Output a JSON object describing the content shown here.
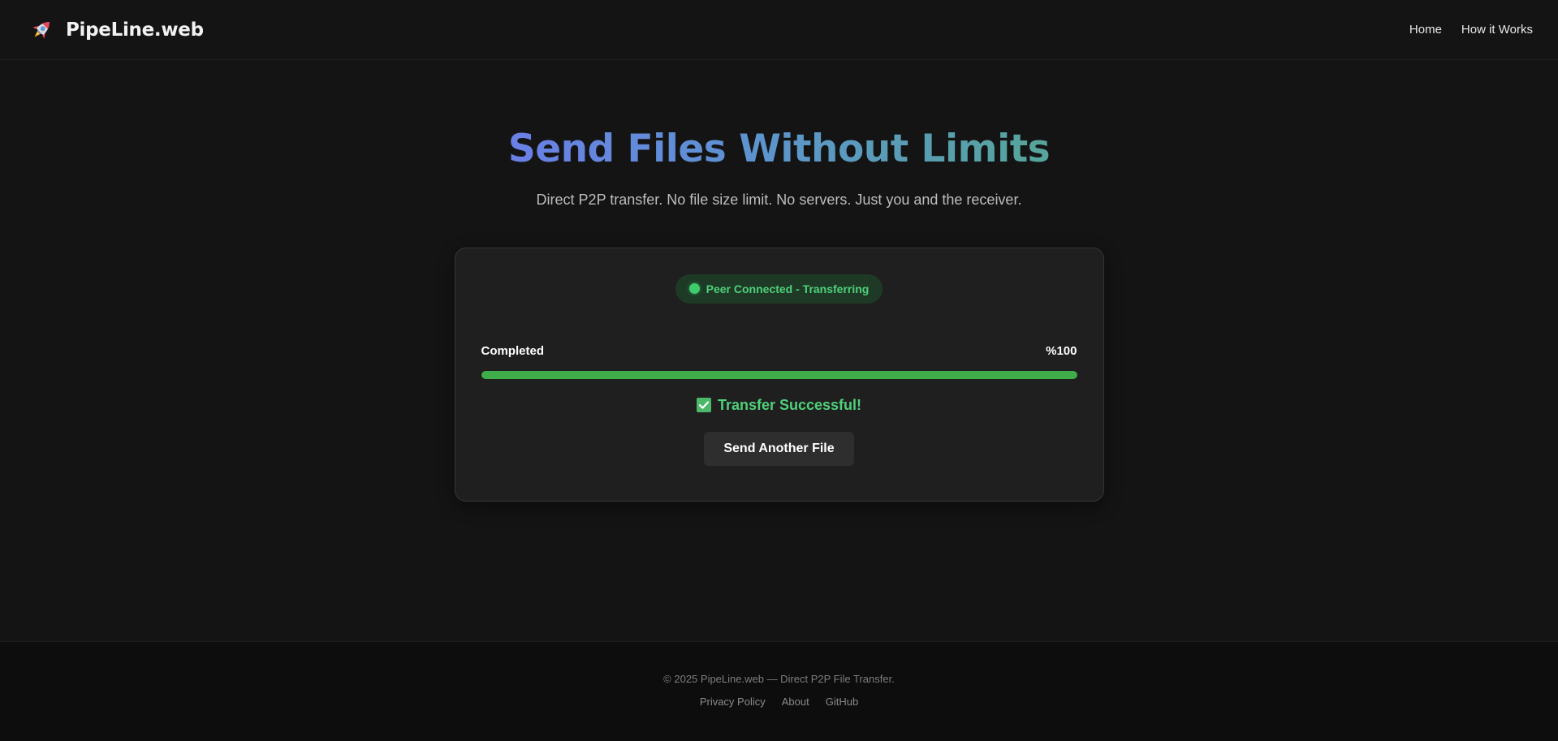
{
  "header": {
    "brand_name": "PipeLine.web",
    "brand_icon": "rocket-icon",
    "nav": [
      {
        "label": "Home"
      },
      {
        "label": "How it Works"
      }
    ]
  },
  "hero": {
    "title": "Send Files Without Limits",
    "subtitle": "Direct P2P transfer. No file size limit. No servers. Just you and the receiver."
  },
  "transfer": {
    "status": "Peer Connected - Transferring",
    "status_color": "#4fd07a",
    "progress_label": "Completed",
    "progress_text": "%100",
    "progress_percent": 100,
    "progress_color": "#3fad4a",
    "result_icon": "check-box-icon",
    "result_text": "Transfer Successful!",
    "button_label": "Send Another File"
  },
  "footer": {
    "copyright": "© 2025 PipeLine.web — Direct P2P File Transfer.",
    "links": [
      {
        "label": "Privacy Policy"
      },
      {
        "label": "About"
      },
      {
        "label": "GitHub"
      }
    ]
  }
}
